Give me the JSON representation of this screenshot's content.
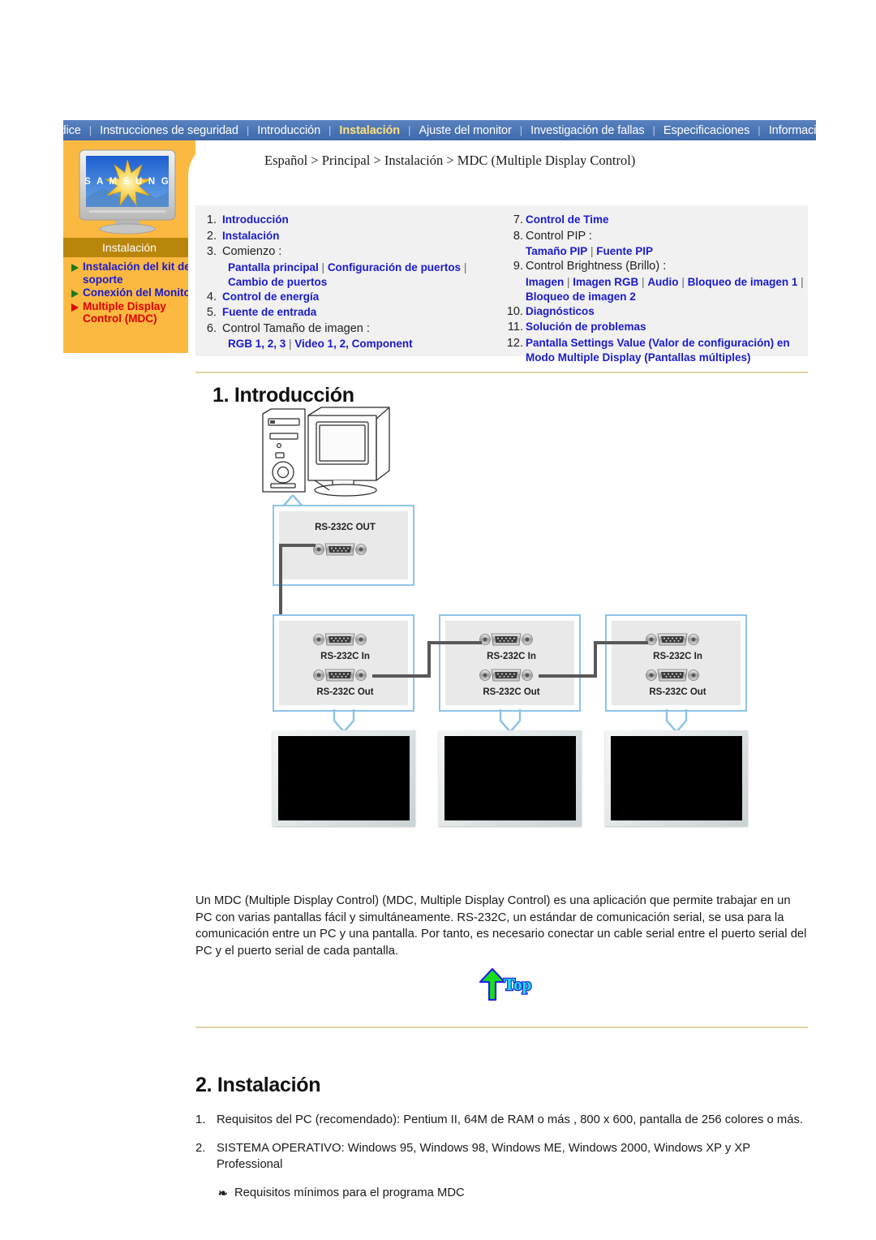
{
  "nav": {
    "items": [
      {
        "label": "Indice",
        "active": false
      },
      {
        "label": "Instrucciones de seguridad",
        "active": false
      },
      {
        "label": "Introducción",
        "active": false
      },
      {
        "label": "Instalación",
        "active": true
      },
      {
        "label": "Ajuste del monitor",
        "active": false
      },
      {
        "label": "Investigación de fallas",
        "active": false
      },
      {
        "label": "Especificaciones",
        "active": false
      },
      {
        "label": "Información",
        "active": false
      }
    ],
    "separator": "|"
  },
  "sidebar": {
    "section_label": "Instalación",
    "brand": "SAMSUNG",
    "items": [
      {
        "label": "Instalación del kit del soporte",
        "active": false
      },
      {
        "label": "Conexión del Monitor",
        "active": false
      },
      {
        "label": "Multiple Display Control (MDC)",
        "active": true
      }
    ]
  },
  "breadcrumb": "Español > Principal > Instalación > MDC (Multiple Display Control)",
  "toc": {
    "left": [
      {
        "num": "1.",
        "text": "Introducción",
        "link": true
      },
      {
        "num": "2.",
        "text": "Instalación",
        "link": true
      },
      {
        "num": "3.",
        "text": "Comienzo :",
        "link": false,
        "sub": "Pantalla principal | Configuración de puertos | Cambio de puertos"
      },
      {
        "num": "4.",
        "text": "Control de energía",
        "link": true
      },
      {
        "num": "5.",
        "text": "Fuente de entrada",
        "link": true
      },
      {
        "num": "6.",
        "text": "Control Tamaño de imagen :",
        "link": false,
        "sub": "RGB 1, 2, 3 | Video 1, 2, Component"
      }
    ],
    "right": [
      {
        "num": "7.",
        "text": "Control de Time",
        "link": true
      },
      {
        "num": "8.",
        "text": "Control PIP :",
        "link": false,
        "sub": "Tamaño PIP | Fuente PIP"
      },
      {
        "num": "9.",
        "text": "Control Brightness (Brillo) :",
        "link": false,
        "sub": "Imagen | Imagen RGB | Audio | Bloqueo de imagen 1 | Bloqueo de imagen 2"
      },
      {
        "num": "10.",
        "text": "Diagnósticos",
        "link": true
      },
      {
        "num": "11.",
        "text": "Solución de problemas",
        "link": true
      },
      {
        "num": "12.",
        "text": "Pantalla Settings Value (Valor de configuración) en Modo Multiple Display (Pantallas múltiples)",
        "link": true
      }
    ]
  },
  "section1": {
    "heading": "1. Introducción",
    "paragraph": "Un MDC (Multiple Display Control) (MDC, Multiple Display Control) es una aplicación que permite trabajar en un PC con varias pantallas fácil y simultáneamente. RS-232C, un estándar de comunicación serial, se usa para la comunicación entre un PC y una pantalla. Por tanto, es necesario conectar un cable serial entre el puerto serial del PC y el puerto serial de cada pantalla."
  },
  "diagram": {
    "pc_out_label": "RS-232C OUT",
    "displays": [
      {
        "in_label": "RS-232C In",
        "out_label": "RS-232C Out"
      },
      {
        "in_label": "RS-232C In",
        "out_label": "RS-232C Out"
      },
      {
        "in_label": "RS-232C In",
        "out_label": "RS-232C Out"
      }
    ]
  },
  "top_button": {
    "label": "Top"
  },
  "section2": {
    "heading": "2. Instalación",
    "items": [
      {
        "num": "1.",
        "text": "Requisitos del PC (recomendado): Pentium II, 64M de RAM o más , 800 x 600, pantalla de 256 colores o más."
      },
      {
        "num": "2.",
        "text": "SISTEMA OPERATIVO: Windows 95, Windows 98, Windows ME, Windows 2000, Windows XP y XP Professional"
      }
    ],
    "note": "Requisitos mínimos para el programa MDC",
    "note_bullet": "❧"
  },
  "colors": {
    "nav_bg": "#4a72b4",
    "nav_active": "#ffe27a",
    "sidebar_bg": "#fcb941",
    "gold_bar": "#b8860b",
    "link": "#1a1ad0",
    "active_link": "#e00000",
    "toc_bg": "#f1f1f1",
    "box_border": "#8fc4e8"
  }
}
